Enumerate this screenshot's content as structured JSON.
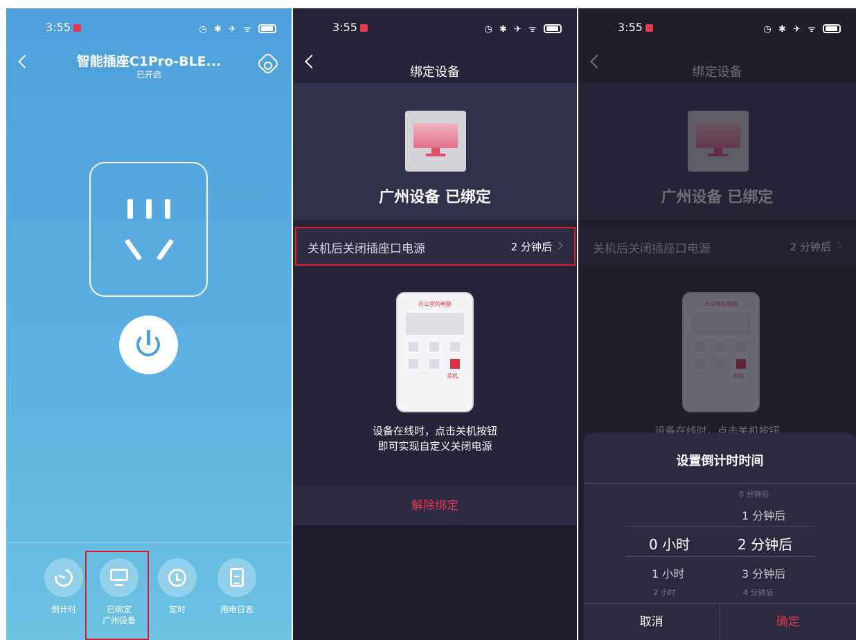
{
  "status_bar": {
    "time": "3:55",
    "icons_text": "◷ ✱ ✈ ᯤ ▣"
  },
  "panel1": {
    "title": "智能插座C1Pro-BLE...",
    "subtitle": "已开启",
    "tabs": [
      {
        "label": "倒计时",
        "icon": "countdown-icon"
      },
      {
        "label": "已绑定\n广州设备",
        "label_line1": "已绑定",
        "label_line2": "广州设备",
        "icon": "monitor-icon"
      },
      {
        "label": "定时",
        "icon": "alarm-clock-icon"
      },
      {
        "label": "用电日志",
        "icon": "log-icon"
      }
    ]
  },
  "panel2": {
    "title": "绑定设备",
    "bound_text": "广州设备 已绑定",
    "setting_label": "关机后关闭插座口电源",
    "setting_value": "2 分钟后",
    "phone_title": "办公室的电脑",
    "phone_power_label": "关机",
    "tip_line1": "设备在线时，点击关机按钮",
    "tip_line2": "即可实现自定义关闭电源",
    "unbind_label": "解除绑定"
  },
  "panel3": {
    "title": "绑定设备",
    "bound_text": "广州设备 已绑定",
    "setting_label": "关机后关闭插座口电源",
    "setting_value": "2 分钟后",
    "phone_title": "办公室的电脑",
    "phone_power_label": "关机",
    "tip_partial": "设备在线时，点击关机按钮",
    "sheet": {
      "title": "设置倒计时时间",
      "hours": [
        "0 小时",
        "1 小时",
        "2 小时"
      ],
      "minutes": [
        "0 分钟后",
        "1 分钟后",
        "2 分钟后",
        "3 分钟后",
        "4 分钟后"
      ],
      "selected_hours": "0 小时",
      "selected_minutes": "2 分钟后",
      "cancel": "取消",
      "confirm": "确定"
    }
  },
  "colors": {
    "accent_red": "#e03850",
    "highlight_box": "#e0192b",
    "dark_bg": "#252438",
    "blue_top": "#4e9fdc"
  }
}
